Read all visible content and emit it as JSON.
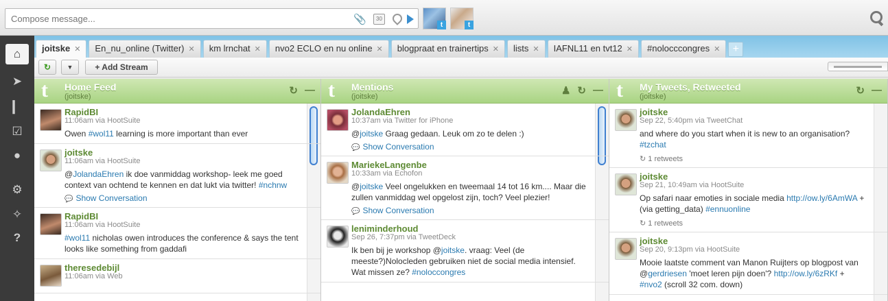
{
  "compose": {
    "placeholder": "Compose message...",
    "calendar_label": "30"
  },
  "profiles": [
    "joitske-twitter",
    "ennuonline-twitter"
  ],
  "tabs": [
    {
      "label": "joitske",
      "active": true
    },
    {
      "label": "En_nu_online (Twitter)"
    },
    {
      "label": "km lrnchat"
    },
    {
      "label": "nvo2 ECLO en nu online"
    },
    {
      "label": "blogpraat en trainertips"
    },
    {
      "label": "lists"
    },
    {
      "label": "IAFNL11 en tvt12"
    },
    {
      "label": "#nolocccongres"
    }
  ],
  "tab_close": "✕",
  "toolbar": {
    "refresh": "↻",
    "dropdown": "▼",
    "add_stream": "+ Add Stream"
  },
  "columns": [
    {
      "title": "Home Feed",
      "sub": "(joitske)",
      "messages": [
        {
          "name": "RapidBI",
          "meta": "11:06am via HootSuite",
          "text": "Owen <a>#wol11</a> learning is more important than ever"
        },
        {
          "name": "joitske",
          "meta": "11:06am via HootSuite",
          "text": "@<a>JolandaEhren</a> ik doe vanmiddag workshop- leek me goed context van ochtend te kennen en dat lukt via twitter! <a>#nchnw</a>",
          "conv": "Show Conversation"
        },
        {
          "name": "RapidBI",
          "meta": "11:06am via HootSuite",
          "text": "<a>#wol11</a> nicholas owen introduces the conference &amp; says the tent looks like something from gaddafi"
        },
        {
          "name": "theresedebijl",
          "meta": "11:06am via Web",
          "text": ""
        }
      ]
    },
    {
      "title": "Mentions",
      "sub": "(joitske)",
      "messages": [
        {
          "name": "JolandaEhren",
          "meta": "10:37am via Twitter for iPhone",
          "text": "@<a>joitske</a> Graag gedaan. Leuk om zo te delen :)",
          "conv": "Show Conversation"
        },
        {
          "name": "MariekeLangenbe",
          "meta": "10:33am via Echofon",
          "text": "@<a>joitske</a> Veel ongelukken en tweemaal 14 tot 16 km.... Maar die zullen vanmiddag wel opgelost zijn, toch? Veel plezier!",
          "conv": "Show Conversation"
        },
        {
          "name": "leniminderhoud",
          "meta": "Sep 26, 7:37pm via TweetDeck",
          "text": "Ik ben bij je workshop @<a>joitske</a>. vraag: Veel (de meeste?)Nolocleden gebruiken niet de social media intensief. Wat missen ze? <a>#noloccongres</a>"
        }
      ]
    },
    {
      "title": "My Tweets, Retweeted",
      "sub": "(joitske)",
      "messages": [
        {
          "name": "joitske",
          "meta": "Sep 22, 5:40pm via TweetChat",
          "text": "and where do you start when it is new to an organisation? <a>#tzchat</a>",
          "rt": "1 retweets"
        },
        {
          "name": "joitske",
          "meta": "Sep 21, 10:49am via HootSuite",
          "text": "Op safari naar emoties in sociale media <a>http://ow.ly/6AmWA</a> + (via getting_data) <a>#ennuonline</a>",
          "rt": "1 retweets"
        },
        {
          "name": "joitske",
          "meta": "Sep 20, 9:13pm via HootSuite",
          "text": "Mooie laatste comment van Manon Ruijters op blogpost van @<a>gerdriesen</a> 'moet leren pijn doen'? <a>http://ow.ly/6zRKf</a> + <a>#nvo2</a> (scroll 32 com. down)"
        }
      ]
    }
  ]
}
